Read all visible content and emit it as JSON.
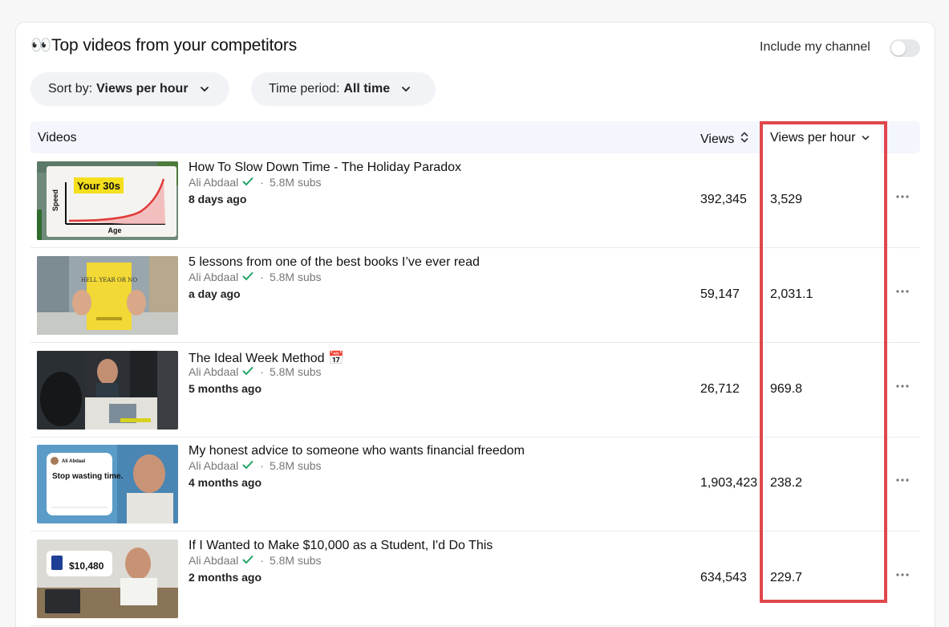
{
  "header": {
    "title": "👀Top videos from your competitors",
    "include_label": "Include my channel"
  },
  "filters": {
    "sort_prefix": "Sort by:",
    "sort_value": "Views per hour",
    "time_prefix": "Time period:",
    "time_value": "All time"
  },
  "table": {
    "col_videos": "Videos",
    "col_views": "Views",
    "col_vph": "Views per hour",
    "rows": [
      {
        "title": "How To Slow Down Time - The Holiday Paradox",
        "channel": "Ali Abdaal",
        "subs": "5.8M subs",
        "age": "8 days ago",
        "views": "392,345",
        "vph": "3,529"
      },
      {
        "title": "5 lessons from one of the best books I’ve ever read",
        "channel": "Ali Abdaal",
        "subs": "5.8M subs",
        "age": "a day ago",
        "views": "59,147",
        "vph": "2,031.1"
      },
      {
        "title": "The Ideal Week Method 📅",
        "channel": "Ali Abdaal",
        "subs": "5.8M subs",
        "age": "5 months ago",
        "views": "26,712",
        "vph": "969.8"
      },
      {
        "title": "My honest advice to someone who wants financial freedom",
        "channel": "Ali Abdaal",
        "subs": "5.8M subs",
        "age": "4 months ago",
        "views": "1,903,423",
        "vph": "238.2"
      },
      {
        "title": "If I Wanted to Make $10,000 as a Student, I'd Do This",
        "channel": "Ali Abdaal",
        "subs": "5.8M subs",
        "age": "2 months ago",
        "views": "634,543",
        "vph": "229.7"
      }
    ]
  },
  "thumbs": {
    "t1_text": "Your 30s",
    "t1_ylabel": "Speed",
    "t1_xlabel": "Age",
    "t2_text": "HELL YEAR OR NO",
    "t4_text": "Stop wasting time.",
    "t4_name": "Ali Abdaal",
    "t5_amount": "$10,480"
  },
  "colors": {
    "accent_highlight": "#e0474c",
    "verified": "#21a366"
  }
}
